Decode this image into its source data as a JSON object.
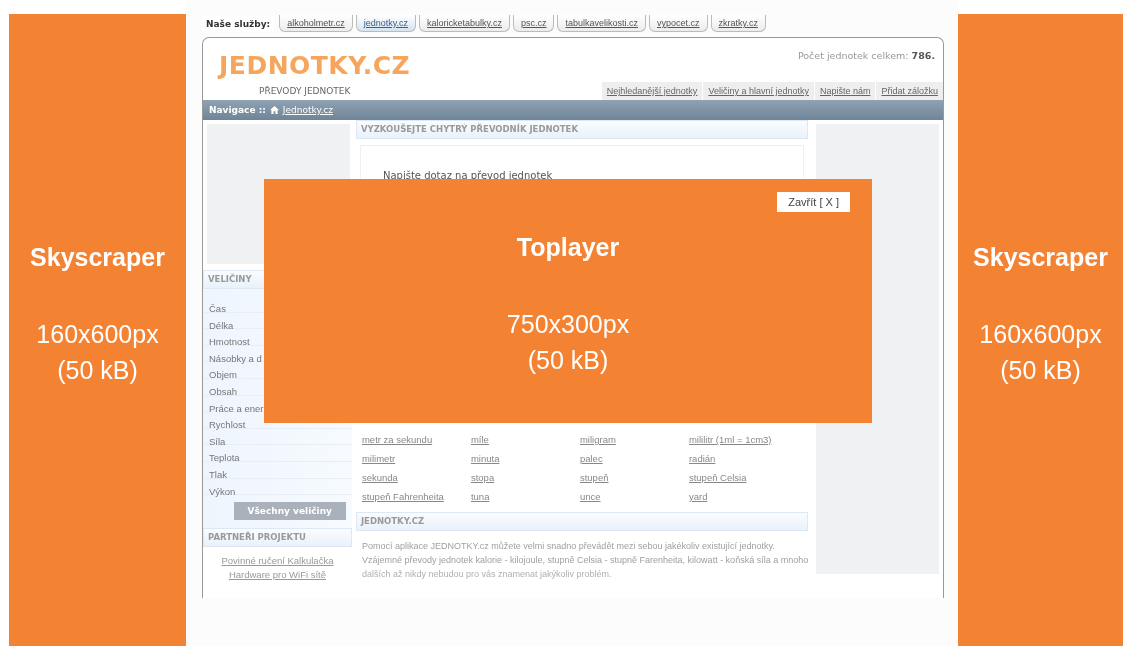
{
  "left_ad": {
    "title": "Skyscraper",
    "size": "160x600px",
    "weight": "(50 kB)"
  },
  "services": {
    "label": "Naše služby:",
    "tabs": [
      {
        "label": "alkoholmetr.cz",
        "selected": false
      },
      {
        "label": "jednotky.cz",
        "selected": true
      },
      {
        "label": "kaloricketabulky.cz",
        "selected": false
      },
      {
        "label": "psc.cz",
        "selected": false
      },
      {
        "label": "tabulkavelikosti.cz",
        "selected": false
      },
      {
        "label": "vypocet.cz",
        "selected": false
      },
      {
        "label": "zkratky.cz",
        "selected": false
      }
    ]
  },
  "header": {
    "logo": "JEDNOTKY.CZ",
    "tagline": "PŘEVODY JEDNOTEK",
    "count_label": "Počet jednotek celkem:",
    "count": "786.",
    "nav": [
      "Nejhledanější jednotky",
      "Veličiny a hlavní jednotky",
      "Napište nám",
      "Přidat záložku"
    ]
  },
  "breadcrumb": {
    "label": "Navigace ::",
    "link": "Jednotky.cz"
  },
  "sidebar": {
    "title": "VELIČINY",
    "items": [
      "Čas",
      "Délka",
      "Hmotnost",
      "Násobky a d",
      "Objem",
      "Obsah",
      "Práce a ener",
      "Rychlost",
      "Síla",
      "Teplota",
      "Tlak",
      "Výkon"
    ],
    "button": "Všechny veličiny",
    "partners_title": "PARTNEŘI PROJEKTU",
    "partners": [
      "Povinné ručení Kalkulačka",
      "Hardware pro WiFi sítě"
    ]
  },
  "converter": {
    "title": "VYZKOUŠEJTE CHYTRÝ PŘEVODNÍK JEDNOTEK",
    "prompt": "Napište dotaz na převod jednotek"
  },
  "unit_links": [
    [
      "metr za sekundu",
      "míle",
      "miligram",
      "mililitr (1ml = 1cm3)"
    ],
    [
      "milimetr",
      "minuta",
      "palec",
      "radián"
    ],
    [
      "sekunda",
      "stopa",
      "stupeň",
      "stupeň Celsia"
    ],
    [
      "stupeň Fahrenheita",
      "tuna",
      "unce",
      "yard"
    ]
  ],
  "about": {
    "title": "JEDNOTKY.CZ",
    "lines": [
      "Pomocí aplikace JEDNOTKY.cz můžete velmi snadno převádět mezi sebou jakékoliv existující jednotky.",
      "Vzájemné převody jednotek kalorie - kilojoule, stupně Celsia - stupně Farenheita, kilowatt - koňská síla a mnoho",
      "dalších až nikdy nebudou pro vás znamenat jakýkoliv problém."
    ]
  },
  "toplayer": {
    "close": "Zavřít [ X ]",
    "title": "Toplayer",
    "size": "750x300px",
    "weight": "(50 kB)"
  },
  "right_ad": {
    "title": "Skyscraper",
    "size": "160x600px",
    "weight": "(50 kB)"
  }
}
